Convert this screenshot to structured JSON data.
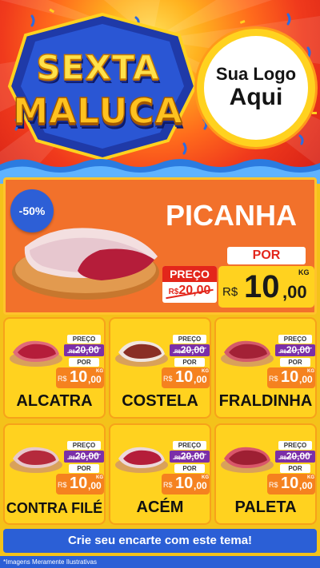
{
  "header": {
    "title_line1": "SEXTA",
    "title_line2": "MALUCA",
    "logo_line1": "Sua Logo",
    "logo_line2": "Aqui"
  },
  "feature": {
    "discount": "-50%",
    "name": "PICANHA",
    "old_label": "PREÇO",
    "old_currency": "R$",
    "old_price": "20,00",
    "new_label": "POR",
    "new_currency": "R$",
    "new_int": "10",
    "new_dec": ",00",
    "unit": "KG"
  },
  "products": [
    {
      "name": "ALCATRA",
      "preco_label": "PREÇO",
      "old_currency": "R$",
      "old_price": "20,00",
      "por_label": "POR",
      "currency": "R$",
      "int": "10",
      "dec": ",00",
      "unit": "KG"
    },
    {
      "name": "COSTELA",
      "preco_label": "PREÇO",
      "old_currency": "R$",
      "old_price": "20,00",
      "por_label": "POR",
      "currency": "R$",
      "int": "10",
      "dec": ",00",
      "unit": "KG"
    },
    {
      "name": "FRALDINHA",
      "preco_label": "PREÇO",
      "old_currency": "R$",
      "old_price": "20,00",
      "por_label": "POR",
      "currency": "R$",
      "int": "10",
      "dec": ",00",
      "unit": "KG"
    },
    {
      "name": "CONTRA FILÉ",
      "preco_label": "PREÇO",
      "old_currency": "R$",
      "old_price": "20,00",
      "por_label": "POR",
      "currency": "R$",
      "int": "10",
      "dec": ",00",
      "unit": "KG"
    },
    {
      "name": "ACÉM",
      "preco_label": "PREÇO",
      "old_currency": "R$",
      "old_price": "20,00",
      "por_label": "POR",
      "currency": "R$",
      "int": "10",
      "dec": ",00",
      "unit": "KG"
    },
    {
      "name": "PALETA",
      "preco_label": "PREÇO",
      "old_currency": "R$",
      "old_price": "20,00",
      "por_label": "POR",
      "currency": "R$",
      "int": "10",
      "dec": ",00",
      "unit": "KG"
    }
  ],
  "footer": {
    "cta": "Crie seu encarte com este tema!",
    "note": "*Imagens Meramente Ilustrativas"
  },
  "colors": {
    "background_yellow": "#ffd21f",
    "header_red": "#f03a1c",
    "feature_orange": "#f2712b",
    "discount_blue": "#2d5fd6",
    "old_price_purple": "#7b2fa8",
    "new_price_orange": "#f5821f"
  }
}
